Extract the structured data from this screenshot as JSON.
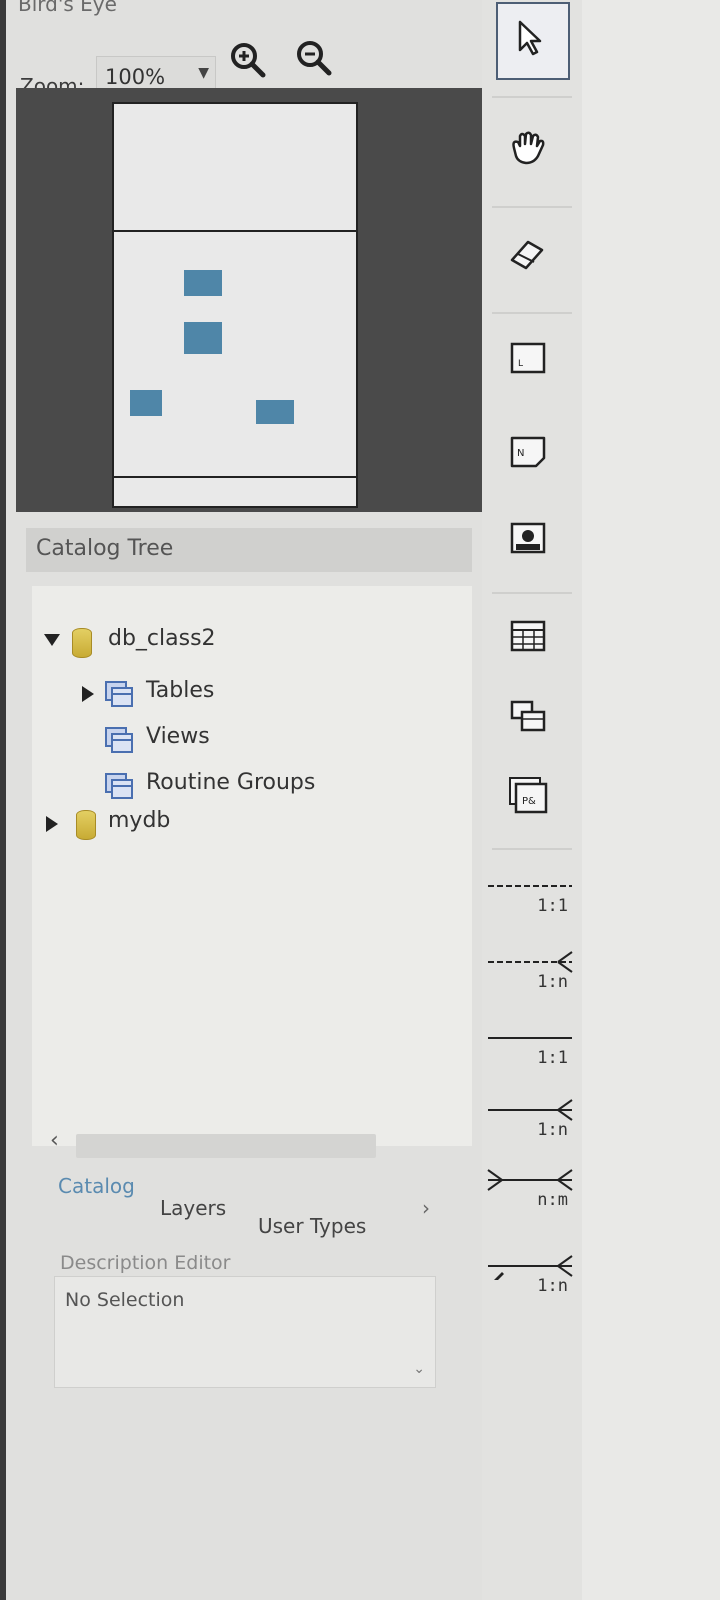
{
  "birdseye": {
    "title": "Bird's Eye",
    "zoom_label": "Zoom:",
    "zoom_value": "100%"
  },
  "catalog": {
    "title": "Catalog Tree",
    "tree": [
      {
        "label": "db_class2",
        "level": 0,
        "expanded": true,
        "icon": "database-icon"
      },
      {
        "label": "Tables",
        "level": 1,
        "expanded": false,
        "icon": "tables-folder-icon"
      },
      {
        "label": "Views",
        "level": 1,
        "icon": "views-folder-icon"
      },
      {
        "label": "Routine Groups",
        "level": 1,
        "icon": "routine-groups-folder-icon"
      },
      {
        "label": "mydb",
        "level": 0,
        "expanded": false,
        "icon": "database-icon"
      }
    ]
  },
  "bottom_tabs": [
    "Catalog",
    "Layers",
    "User Types"
  ],
  "description_editor": {
    "title": "Description Editor",
    "value": "No Selection"
  },
  "toolbar": {
    "tools": [
      "pointer-icon",
      "hand-icon",
      "eraser-icon",
      "layer-icon",
      "note-icon",
      "image-icon",
      "table-icon",
      "view-icon",
      "routine-group-icon"
    ],
    "relationships": [
      {
        "label": "1:1",
        "icon": "non-identifying-1-1-icon"
      },
      {
        "label": "1:n",
        "icon": "non-identifying-1-n-icon"
      },
      {
        "label": "1:1",
        "icon": "identifying-1-1-icon"
      },
      {
        "label": "1:n",
        "icon": "identifying-1-n-icon"
      },
      {
        "label": "n:m",
        "icon": "identifying-n-m-icon"
      },
      {
        "label": "1:n",
        "icon": "relationship-existing-columns-icon"
      }
    ]
  },
  "colors": {
    "accent": "#5b8bb0",
    "folder": "#4a6fb0",
    "database": "#d4bb45",
    "birdseye_block": "#4f86a8"
  }
}
